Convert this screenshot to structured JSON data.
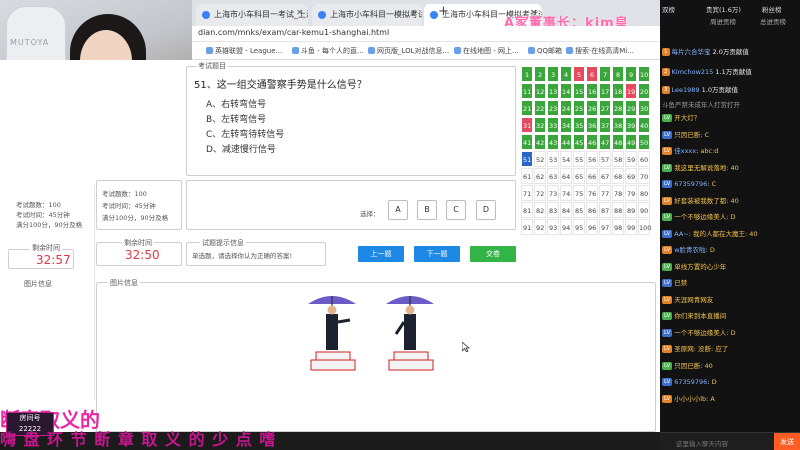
{
  "overlay": {
    "title": "A家董事长：kim皇",
    "banner": "嗨 盘 环 节   断 章 取 义 的 少 点 嗜",
    "overlay_text": "断章取义的",
    "room_label": "房间号",
    "room_number": "22222"
  },
  "browser": {
    "tabs": [
      {
        "label": "上海市小车科目一考试_上海市科...",
        "active": false
      },
      {
        "label": "上海市小车科目一模拟考试驾驶...",
        "active": false
      },
      {
        "label": "上海市小车科目一模拟考试试...",
        "active": true
      }
    ],
    "url": "dian.com/mnks/exam/car-kemu1-shanghai.html",
    "bookmarks": [
      "英雄联盟 - League...",
      "斗鱼 - 每个人的直...",
      "网页版_LOL对战信息...",
      "在线地图 - 网上...",
      "QQ邮箱",
      "搜索·在线高清Mi..."
    ]
  },
  "exam": {
    "section_label": "考试题目",
    "question": "51、这一组交通警察手势是什么信号？",
    "options": [
      "A、右转弯信号",
      "B、左转弯信号",
      "C、左转弯待转信号",
      "D、减速慢行信号"
    ],
    "answer_label": "选择：",
    "answer_buttons": [
      "A",
      "B",
      "C",
      "D"
    ],
    "info": {
      "subject": "考试题数：100",
      "time": "考试时间：45分钟",
      "score": "满分100分，90分及格"
    },
    "timer_label": "剩余时间",
    "timer_value": "32:50",
    "left_timer_label": "剩余时间",
    "left_timer_value": "32:57",
    "hint_label": "试题提示信息",
    "hint_text": "单选题，请选择你认为正确的答案!",
    "buttons": {
      "prev": "上一题",
      "next": "下一题",
      "submit": "交卷"
    },
    "image_section_label": "图片信息",
    "left_image_label": "图片信息",
    "left_info": {
      "subject": "考试题数：100",
      "time": "考试时间：45分钟",
      "score": "满分100分，90分及格"
    }
  },
  "answer_grid": {
    "numbers": [
      1,
      2,
      3,
      4,
      5,
      6,
      7,
      8,
      9,
      10,
      11,
      12,
      13,
      14,
      15,
      16,
      17,
      18,
      19,
      20,
      21,
      22,
      23,
      24,
      25,
      26,
      27,
      28,
      29,
      30,
      31,
      32,
      33,
      34,
      35,
      36,
      37,
      38,
      39,
      40,
      41,
      42,
      43,
      44,
      45,
      46,
      47,
      48,
      49,
      50,
      51,
      52,
      53,
      54,
      55,
      56,
      57,
      58,
      59,
      60,
      61,
      62,
      63,
      64,
      65,
      66,
      67,
      68,
      69,
      70,
      71,
      72,
      73,
      74,
      75,
      76,
      77,
      78,
      79,
      80,
      81,
      82,
      83,
      84,
      85,
      86,
      87,
      88,
      89,
      90,
      91,
      92,
      93,
      94,
      95,
      96,
      97,
      98,
      99,
      100
    ],
    "wrong": [
      5,
      6,
      19,
      31
    ],
    "current": 51,
    "answered_max": 50,
    "colors": {
      "correct": "#3aa53a",
      "wrong": "#e64a5f",
      "current": "#2a66c8",
      "pending": "#ffffff"
    }
  },
  "chat": {
    "tabs": [
      "双榜",
      "贵宾(1.6万)",
      "粉丝榜"
    ],
    "sub_tabs": [
      "周进贡榜",
      "总进贡榜"
    ],
    "rank": [
      {
        "name": "每片六合华宝",
        "value": "2.0万贡献值"
      },
      {
        "name": "Kimchow215",
        "value": "1.1万贡献值"
      },
      {
        "name": "Lee1989",
        "value": "1.0万贡献值"
      }
    ],
    "notice": "斗鱼严禁未成年人打赏打开",
    "lines": [
      {
        "name": "",
        "msg": "开大灯？"
      },
      {
        "name": "",
        "msg": "只因已断: C"
      },
      {
        "name": "佳xxxx",
        "msg": "abc:d"
      },
      {
        "name": "",
        "msg": "我这里无解说落地: 40"
      },
      {
        "name": "67359796",
        "msg": "C"
      },
      {
        "name": "",
        "msg": "好套装被我数了都: 40"
      },
      {
        "name": "",
        "msg": "一个不够边缘美人: D"
      },
      {
        "name": "AA~",
        "msg": "我的人都在大魔王: 40"
      },
      {
        "name": "w脸青农啦",
        "msg": "D"
      },
      {
        "name": "",
        "msg": "单线方置的心少年"
      },
      {
        "name": "",
        "msg": "已禁"
      },
      {
        "name": "",
        "msg": "天涯网青网友"
      },
      {
        "name": "",
        "msg": "你们来到本直播间"
      },
      {
        "name": "",
        "msg": "一个不够边缘美人: D"
      },
      {
        "name": "",
        "msg": "圣原网: 没断: 应了"
      },
      {
        "name": "",
        "msg": "只因已断: 40"
      },
      {
        "name": "67359796",
        "msg": "D"
      },
      {
        "name": "",
        "msg": "小小小小lb: A"
      }
    ],
    "input_placeholder": "这里输入聊天内容",
    "send": "发送"
  }
}
